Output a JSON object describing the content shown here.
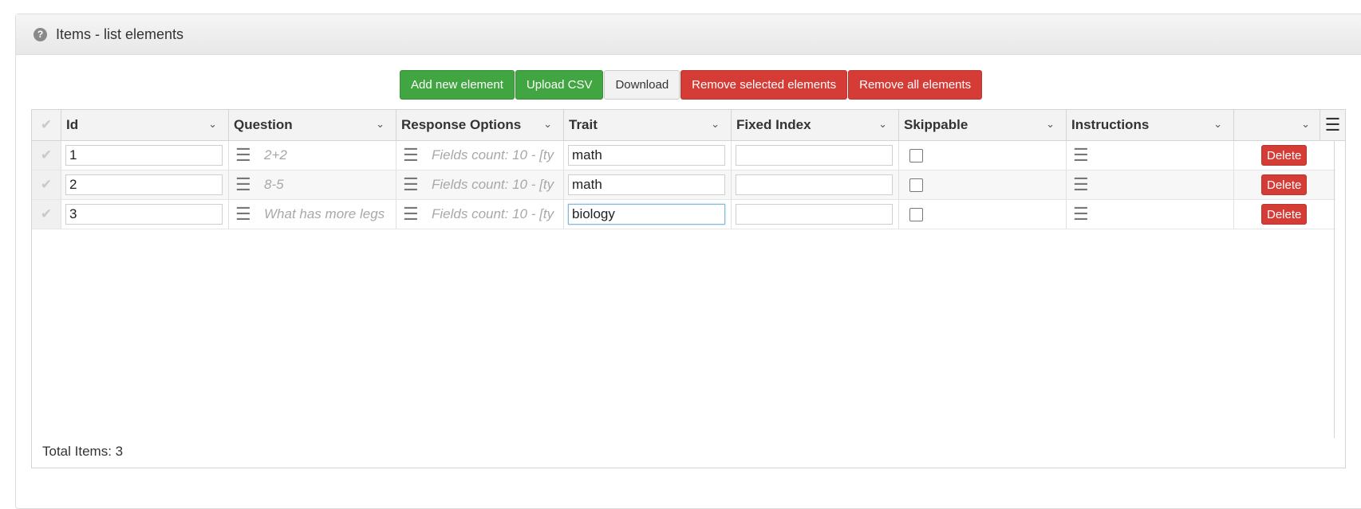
{
  "panel": {
    "title": "Items - list elements",
    "icon": "question-circle-icon"
  },
  "toolbar": {
    "add": "Add new element",
    "upload": "Upload CSV",
    "download": "Download",
    "remove_selected": "Remove selected elements",
    "remove_all": "Remove all elements"
  },
  "columns": {
    "id": "Id",
    "question": "Question",
    "response_options": "Response Options",
    "trait": "Trait",
    "fixed_index": "Fixed Index",
    "skippable": "Skippable",
    "instructions": "Instructions"
  },
  "rows": [
    {
      "id": "1",
      "question": "2+2",
      "response_options": "Fields count: 10 - [ty",
      "trait": "math",
      "fixed_index": "",
      "skippable": false,
      "delete": "Delete"
    },
    {
      "id": "2",
      "question": "8-5",
      "response_options": "Fields count: 10 - [ty",
      "trait": "math",
      "fixed_index": "",
      "skippable": false,
      "delete": "Delete"
    },
    {
      "id": "3",
      "question": "What has more legs",
      "response_options": "Fields count: 10 - [ty",
      "trait": "biology",
      "fixed_index": "",
      "skippable": false,
      "delete": "Delete"
    }
  ],
  "footer": {
    "total": "Total Items: 3"
  },
  "colors": {
    "green": "#41a541",
    "red": "#d63c36"
  }
}
